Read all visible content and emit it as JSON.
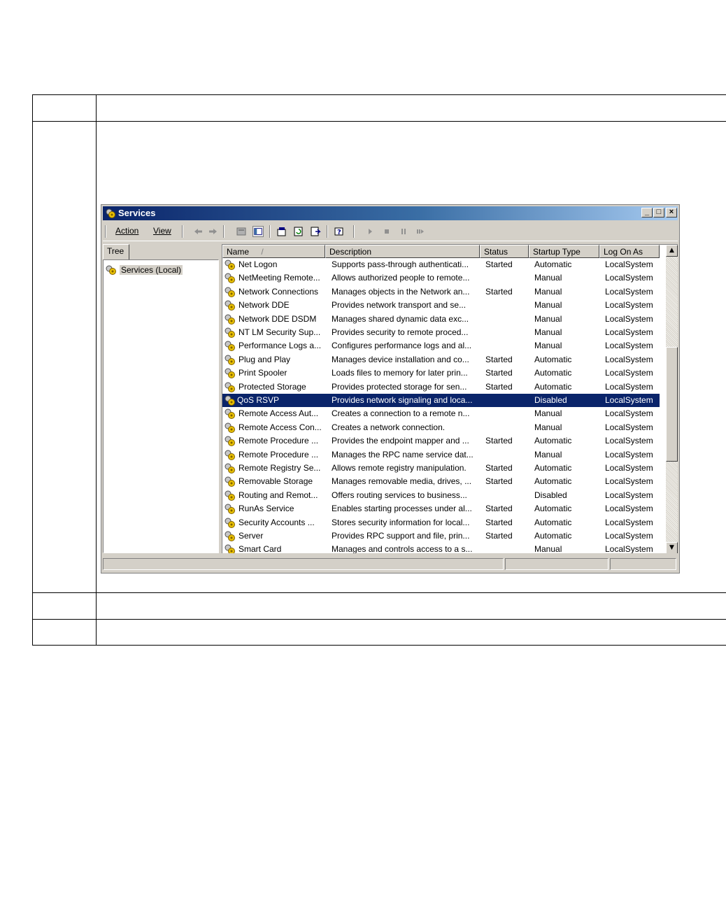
{
  "window": {
    "title": "Services",
    "min_label": "_",
    "max_label": "□",
    "close_label": "×"
  },
  "menu": {
    "action": "Action",
    "view": "View"
  },
  "toolbar_icons": [
    "back-icon",
    "forward-icon",
    "up-icon",
    "show-hide-tree-icon",
    "properties-icon",
    "refresh-icon",
    "export-list-icon",
    "help-icon",
    "start-icon",
    "stop-icon",
    "pause-icon",
    "restart-icon"
  ],
  "tree": {
    "tab_label": "Tree",
    "root_label": "Services (Local)"
  },
  "columns": {
    "name": "Name",
    "sort_indicator": "/",
    "description": "Description",
    "status": "Status",
    "startup_type": "Startup Type",
    "log_on_as": "Log On As"
  },
  "services": [
    {
      "name": "Net Logon",
      "description": "Supports pass-through authenticati...",
      "status": "Started",
      "startup": "Automatic",
      "logon": "LocalSystem"
    },
    {
      "name": "NetMeeting Remote...",
      "description": "Allows authorized people to remote...",
      "status": "",
      "startup": "Manual",
      "logon": "LocalSystem"
    },
    {
      "name": "Network Connections",
      "description": "Manages objects in the Network an...",
      "status": "Started",
      "startup": "Manual",
      "logon": "LocalSystem"
    },
    {
      "name": "Network DDE",
      "description": "Provides network transport and se...",
      "status": "",
      "startup": "Manual",
      "logon": "LocalSystem"
    },
    {
      "name": "Network DDE DSDM",
      "description": "Manages shared dynamic data exc...",
      "status": "",
      "startup": "Manual",
      "logon": "LocalSystem"
    },
    {
      "name": "NT LM Security Sup...",
      "description": "Provides security to remote proced...",
      "status": "",
      "startup": "Manual",
      "logon": "LocalSystem"
    },
    {
      "name": "Performance Logs a...",
      "description": "Configures performance logs and al...",
      "status": "",
      "startup": "Manual",
      "logon": "LocalSystem"
    },
    {
      "name": "Plug and Play",
      "description": "Manages device installation and co...",
      "status": "Started",
      "startup": "Automatic",
      "logon": "LocalSystem"
    },
    {
      "name": "Print Spooler",
      "description": "Loads files to memory for later prin...",
      "status": "Started",
      "startup": "Automatic",
      "logon": "LocalSystem"
    },
    {
      "name": "Protected Storage",
      "description": "Provides protected storage for sen...",
      "status": "Started",
      "startup": "Automatic",
      "logon": "LocalSystem"
    },
    {
      "name": "QoS RSVP",
      "description": "Provides network signaling and loca...",
      "status": "",
      "startup": "Disabled",
      "logon": "LocalSystem",
      "selected": true
    },
    {
      "name": "Remote Access Aut...",
      "description": "Creates a connection to a remote n...",
      "status": "",
      "startup": "Manual",
      "logon": "LocalSystem"
    },
    {
      "name": "Remote Access Con...",
      "description": "Creates a network connection.",
      "status": "",
      "startup": "Manual",
      "logon": "LocalSystem"
    },
    {
      "name": "Remote Procedure ...",
      "description": "Provides the endpoint mapper and ...",
      "status": "Started",
      "startup": "Automatic",
      "logon": "LocalSystem"
    },
    {
      "name": "Remote Procedure ...",
      "description": "Manages the RPC name service dat...",
      "status": "",
      "startup": "Manual",
      "logon": "LocalSystem"
    },
    {
      "name": "Remote Registry Se...",
      "description": "Allows remote registry manipulation.",
      "status": "Started",
      "startup": "Automatic",
      "logon": "LocalSystem"
    },
    {
      "name": "Removable Storage",
      "description": "Manages removable media, drives, ...",
      "status": "Started",
      "startup": "Automatic",
      "logon": "LocalSystem"
    },
    {
      "name": "Routing and Remot...",
      "description": "Offers routing services to business...",
      "status": "",
      "startup": "Disabled",
      "logon": "LocalSystem"
    },
    {
      "name": "RunAs Service",
      "description": "Enables starting processes under al...",
      "status": "Started",
      "startup": "Automatic",
      "logon": "LocalSystem"
    },
    {
      "name": "Security Accounts ...",
      "description": "Stores security information for local...",
      "status": "Started",
      "startup": "Automatic",
      "logon": "LocalSystem"
    },
    {
      "name": "Server",
      "description": "Provides RPC support and file, prin...",
      "status": "Started",
      "startup": "Automatic",
      "logon": "LocalSystem"
    },
    {
      "name": "Smart Card",
      "description": "Manages and controls access to a s...",
      "status": "",
      "startup": "Manual",
      "logon": "LocalSystem"
    }
  ],
  "colors": {
    "title_start": "#0a246a",
    "title_end": "#a6caf0",
    "selection": "#0a246a",
    "face": "#d4d0c8"
  }
}
